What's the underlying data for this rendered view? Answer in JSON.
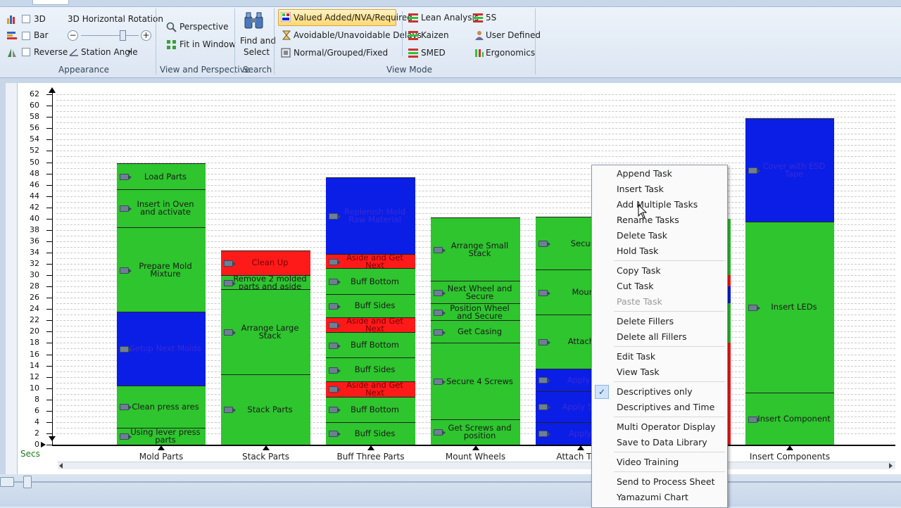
{
  "ribbon": {
    "appearance": {
      "cb_3d": "3D",
      "cb_bar": "Bar",
      "cb_reverse": "Reverse",
      "rotation_label": "3D Horizontal Rotation",
      "station_angle": "Station Angle",
      "group_label": "Appearance"
    },
    "view": {
      "perspective": "Perspective",
      "fit": "Fit in Window",
      "group_label": "View and Perspective"
    },
    "search": {
      "find_line1": "Find and",
      "find_line2": "Select",
      "group_label": "Search"
    },
    "viewmode": {
      "va": "Valued Added/NVA/Required",
      "delays": "Avoidable/Unavoidable Delays",
      "normal": "Normal/Grouped/Fixed",
      "lean": "Lean Analysis",
      "kaizen": "Kaizen",
      "smed": "SMED",
      "s5": "5S",
      "user": "User Defined",
      "ergo": "Ergonomics",
      "group_label": "View Mode"
    }
  },
  "chart_data": {
    "type": "bar",
    "stacked": true,
    "y_unit_label": "Secs",
    "ylim": [
      0,
      62
    ],
    "yticks": [
      "62",
      "60",
      "58",
      "56",
      "54",
      "52",
      "50",
      "48",
      "46",
      "44",
      "42",
      "40",
      "38",
      "36",
      "34",
      "32",
      "30",
      "28",
      "26",
      "24",
      "22",
      "20",
      "18",
      "16",
      "14",
      "12",
      "10",
      "8",
      "6",
      "4",
      "2",
      "0"
    ],
    "colors": {
      "value_added": "#2ec52e",
      "non_value_added": "#ff1a1a",
      "required": "#0a1ee6"
    },
    "stations": [
      {
        "name": "Mold Parts",
        "tasks": [
          {
            "label": "Using lever press parts",
            "start": 0,
            "end": 3,
            "type": "value_added"
          },
          {
            "label": "Clean press ares",
            "start": 3,
            "end": 10.5,
            "type": "value_added"
          },
          {
            "label": "Setup Next Molds",
            "start": 10.5,
            "end": 23.5,
            "type": "required"
          },
          {
            "label": "Prepare Mold Mixture",
            "start": 23.5,
            "end": 38.5,
            "type": "value_added"
          },
          {
            "label": "Insert in Oven and activate",
            "start": 38.5,
            "end": 45.2,
            "type": "value_added"
          },
          {
            "label": "Load Parts",
            "start": 45.2,
            "end": 49.8,
            "type": "value_added"
          }
        ]
      },
      {
        "name": "Stack Parts",
        "tasks": [
          {
            "label": "Stack Parts",
            "start": 0,
            "end": 12.5,
            "type": "value_added"
          },
          {
            "label": "Arrange Large Stack",
            "start": 12.5,
            "end": 27.5,
            "type": "value_added"
          },
          {
            "label": "Remove 2 molded parts and aside",
            "start": 27.5,
            "end": 30,
            "type": "value_added"
          },
          {
            "label": "Clean Up",
            "start": 30,
            "end": 34.4,
            "type": "non_value_added"
          }
        ]
      },
      {
        "name": "Buff Three Parts",
        "tasks": [
          {
            "label": "Buff Sides",
            "start": 0,
            "end": 4,
            "type": "value_added"
          },
          {
            "label": "Buff Bottom",
            "start": 4,
            "end": 8.5,
            "type": "value_added"
          },
          {
            "label": "Aside and Get Next",
            "start": 8.5,
            "end": 11.2,
            "type": "non_value_added"
          },
          {
            "label": "Buff Sides",
            "start": 11.2,
            "end": 15.4,
            "type": "value_added"
          },
          {
            "label": "Buff Bottom",
            "start": 15.4,
            "end": 19.9,
            "type": "value_added"
          },
          {
            "label": "Aside and Get Next",
            "start": 19.9,
            "end": 22.5,
            "type": "non_value_added"
          },
          {
            "label": "Buff Sides",
            "start": 22.5,
            "end": 26.7,
            "type": "value_added"
          },
          {
            "label": "Buff Bottom",
            "start": 26.7,
            "end": 31.2,
            "type": "value_added"
          },
          {
            "label": "Aside and Get Next",
            "start": 31.2,
            "end": 33.8,
            "type": "non_value_added"
          },
          {
            "label": "Replenish Mold Raw Material",
            "start": 33.8,
            "end": 47.3,
            "type": "required"
          }
        ]
      },
      {
        "name": "Mount Wheels",
        "tasks": [
          {
            "label": "Get Screws and position",
            "start": 0,
            "end": 4.5,
            "type": "value_added"
          },
          {
            "label": "Secure 4 Screws",
            "start": 4.5,
            "end": 18,
            "type": "value_added"
          },
          {
            "label": "Get Casing",
            "start": 18,
            "end": 22,
            "type": "value_added"
          },
          {
            "label": "Position Wheel and Secure",
            "start": 22,
            "end": 25,
            "type": "value_added"
          },
          {
            "label": "Next Wheel and Secure",
            "start": 25,
            "end": 29,
            "type": "value_added"
          },
          {
            "label": "Arrange Small Stack",
            "start": 29,
            "end": 40.2,
            "type": "value_added"
          }
        ]
      },
      {
        "name": "Attach Trim",
        "tasks": [
          {
            "label": "Apply Fi",
            "start": 0,
            "end": 4,
            "type": "required"
          },
          {
            "label": "Apply Seco",
            "start": 4,
            "end": 9.5,
            "type": "required"
          },
          {
            "label": "Apply Fir",
            "start": 9.5,
            "end": 13.5,
            "type": "required"
          },
          {
            "label": "Attach F",
            "start": 13.5,
            "end": 23,
            "type": "value_added"
          },
          {
            "label": "Mount",
            "start": 23,
            "end": 31,
            "type": "value_added"
          },
          {
            "label": "Secure",
            "start": 31,
            "end": 40.3,
            "type": "value_added"
          }
        ]
      },
      {
        "name": "Insert Components",
        "tasks": [
          {
            "label": "Insert Component",
            "start": 0,
            "end": 9.2,
            "type": "value_added"
          },
          {
            "label": "Insert LEDs",
            "start": 9.2,
            "end": 39.5,
            "type": "value_added"
          },
          {
            "label": "Cover with ESD Tape",
            "start": 39.5,
            "end": 57.8,
            "type": "required"
          }
        ]
      }
    ]
  },
  "context_menu": {
    "items": [
      {
        "label": "Append Task"
      },
      {
        "label": "Insert Task"
      },
      {
        "label": "Add Multiple Tasks"
      },
      {
        "label": "Rename Tasks"
      },
      {
        "label": "Delete Task"
      },
      {
        "label": "Hold Task"
      },
      {
        "label": "Copy Task"
      },
      {
        "label": "Cut Task"
      },
      {
        "label": "Paste Task"
      },
      {
        "label": "Delete Fillers"
      },
      {
        "label": "Delete all Fillers"
      },
      {
        "label": "Edit Task"
      },
      {
        "label": "View Task"
      },
      {
        "label": "Descriptives only"
      },
      {
        "label": "Descriptives and Time"
      },
      {
        "label": "Multi Operator Display"
      },
      {
        "label": "Save to Data Library"
      },
      {
        "label": "Video Training"
      },
      {
        "label": "Send to Process Sheet"
      },
      {
        "label": "Yamazumi Chart"
      }
    ],
    "checked_item": "Descriptives only",
    "disabled_item": "Paste Task"
  }
}
